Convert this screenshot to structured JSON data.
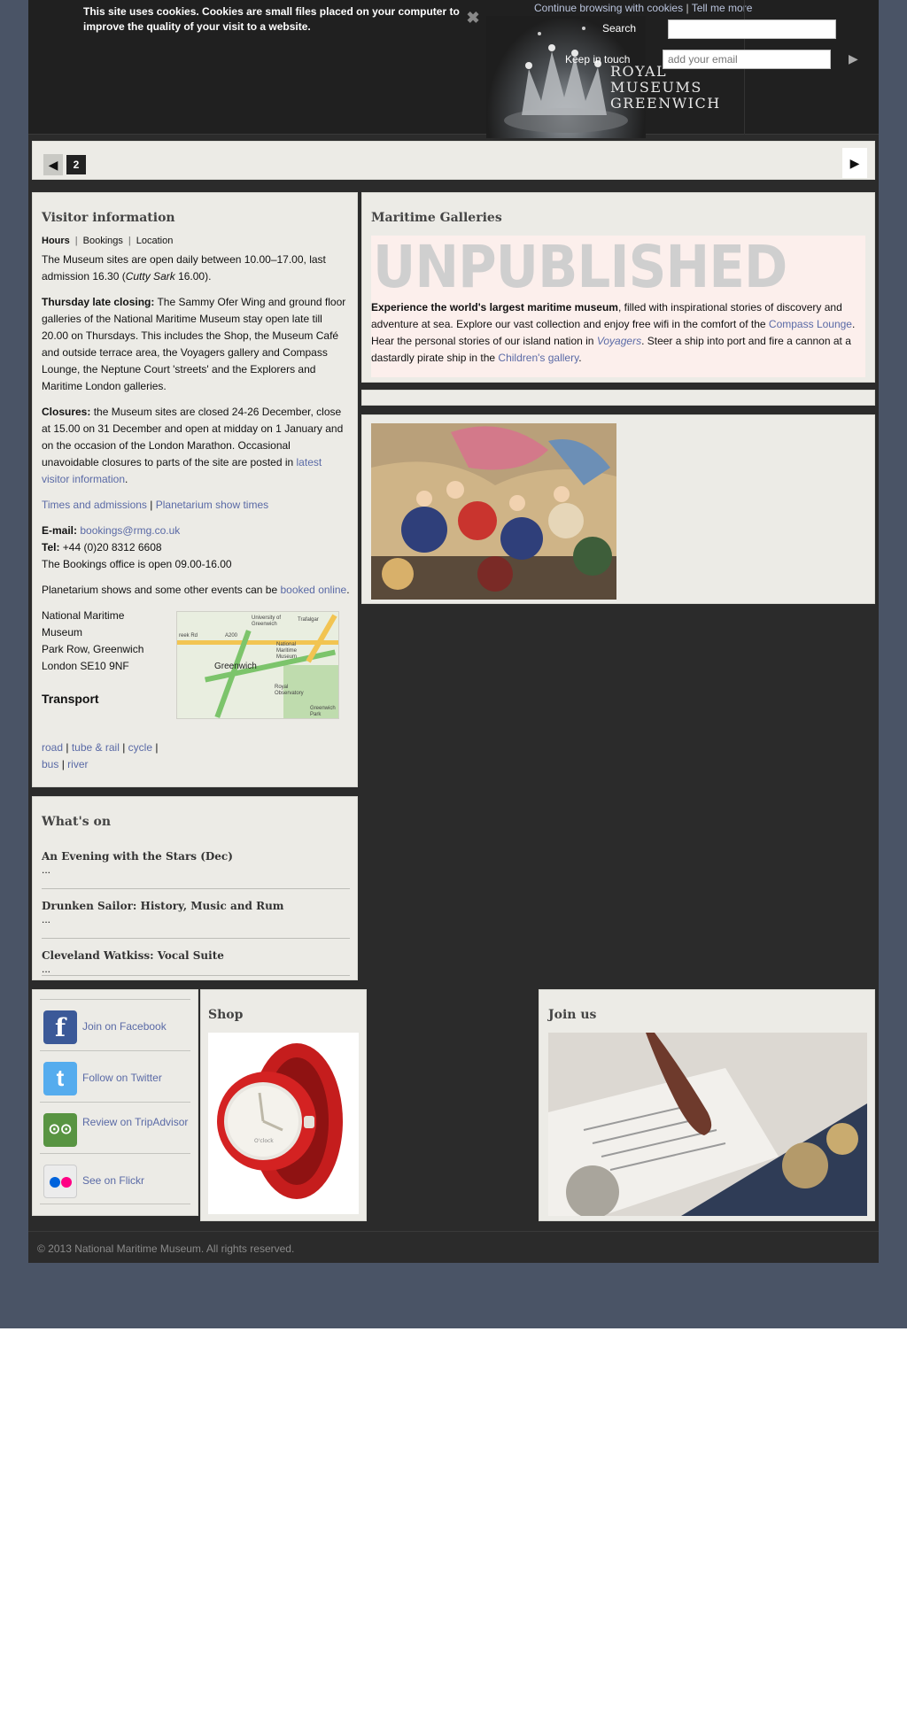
{
  "cookie_banner": {
    "message": "This site uses cookies. Cookies are small files placed on your computer to improve the quality of your visit to a website.",
    "continue_link": "Continue browsing with cookies",
    "separator": "|",
    "tell_more_link": "Tell me more",
    "close_icon": "close-icon"
  },
  "header": {
    "logo_text": [
      "ROYAL",
      "MUSEUMS",
      "GREENWICH"
    ],
    "search_label": "Search",
    "search_value": "",
    "keep_in_touch_label": "Keep in touch",
    "email_placeholder": "add your email",
    "submit_icon": "arrow-right-icon"
  },
  "carousel": {
    "prev_icon": "arrow-left-icon",
    "current_page": "2",
    "next_icon": "arrow-right-icon"
  },
  "visitor": {
    "title": "Visitor information",
    "tabs": [
      {
        "label": "Hours",
        "active": true
      },
      {
        "label": "Bookings",
        "active": false
      },
      {
        "label": "Location",
        "active": false
      }
    ],
    "hours_pre": "The Museum sites are open daily between 10.00–17.00, last admission 16.30 (",
    "hours_italic": "Cutty Sark",
    "hours_post": " 16.00).",
    "thursday_bold": "Thursday late closing:",
    "thursday_text": " The Sammy Ofer Wing and ground floor galleries of the National Maritime Museum stay open late till 20.00 on Thursdays. This includes the Shop, the Museum Café and outside terrace area, the Voyagers gallery and Compass Lounge, the Neptune Court 'streets' and the Explorers and Maritime London galleries.",
    "closures_bold": "Closures:",
    "closures_text": " the Museum sites are closed 24-26 December, close at 15.00 on 31 December and open at midday on 1 January and on the occasion of the London Marathon. Occasional unavoidable closures to parts of the site are posted in ",
    "closures_link": "latest visitor information",
    "closures_end": ".",
    "times_link": "Times and admissions",
    "times_sep": " | ",
    "planetarium_link": "Planetarium show times",
    "email_label": "E-mail:",
    "email_value": "bookings@rmg.co.uk",
    "tel_label": "Tel:",
    "tel_value": " +44 (0)20 8312 6608",
    "bookings_hours": "The Bookings office is open 09.00-16.00",
    "planetarium_pre": "Planetarium shows and some other events can be ",
    "planetarium_booked": "booked online",
    "planetarium_end": ".",
    "address": [
      "National Maritime Museum",
      "Park Row, Greenwich",
      "London SE10 9NF"
    ],
    "transport_title": "Transport",
    "transport_links": [
      "road",
      "tube & rail",
      "cycle",
      "bus",
      "river"
    ],
    "map_labels": {
      "greenwich": "Greenwich",
      "university": "University of Greenwich",
      "nmm": "National Maritime Museum",
      "observatory": "Royal Observatory",
      "park": "Greenwich Park",
      "a200": "A200",
      "creek": "reek Rd",
      "trafalgar": "Trafalgar"
    }
  },
  "whatson": {
    "title": "What's on",
    "items": [
      {
        "title": "An Evening with the Stars (Dec)",
        "desc": "..."
      },
      {
        "title": "Drunken Sailor: History, Music and Rum",
        "desc": "..."
      },
      {
        "title": "Cleveland Watkiss: Vocal Suite",
        "desc": "..."
      }
    ]
  },
  "maritime": {
    "title": "Maritime Galleries",
    "watermark": "UNPUBLISHED",
    "lead_bold": "Experience the world's largest maritime museum",
    "text1": ", filled with inspirational stories of discovery and adventure at sea. Explore our vast collection and enjoy free wifi in the comfort of the ",
    "compass_link": "Compass Lounge",
    "text2": ". Hear the personal stories of our island nation in ",
    "voyagers_link": "Voyagers",
    "text3": ". Steer a ship into port and fire a cannon at a dastardly pirate ship in the ",
    "childrens_link": "Children's gallery",
    "text4": "."
  },
  "social": {
    "items": [
      {
        "label": "Join on Facebook",
        "icon": "facebook-icon",
        "glyph": "f",
        "color": "#3b5998"
      },
      {
        "label": "Follow on Twitter",
        "icon": "twitter-icon",
        "glyph": "t",
        "color": "#55acee"
      },
      {
        "label": "Review on TripAdvisor",
        "icon": "tripadvisor-icon",
        "glyph": "oo",
        "color": "#589442"
      },
      {
        "label": "See on Flickr",
        "icon": "flickr-icon",
        "glyph": "",
        "color": "#e8e8e8"
      }
    ]
  },
  "shop": {
    "title": "Shop",
    "product_brand": "O'clock"
  },
  "joinus": {
    "title": "Join us"
  },
  "footer": {
    "copyright": "© 2013 National Maritime Museum. All rights reserved."
  }
}
